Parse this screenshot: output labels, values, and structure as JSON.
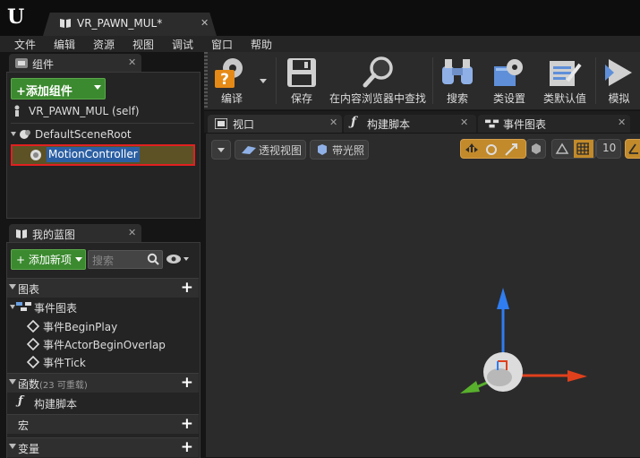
{
  "window": {
    "tab_title": "VR_PAWN_MUL*",
    "tab_close": "✕"
  },
  "menu": [
    "文件",
    "编辑",
    "资源",
    "视图",
    "调试",
    "窗口",
    "帮助"
  ],
  "components_panel": {
    "title": "组件",
    "close": "✕",
    "add_button": "+添加组件",
    "self_item": "VR_PAWN_MUL (self)",
    "root_item": "DefaultSceneRoot",
    "selected_item": "MotionController"
  },
  "blueprint_panel": {
    "title": "我的蓝图",
    "close": "✕",
    "add_new": "添加新项",
    "search_placeholder": "搜索",
    "sections": {
      "graphs": "图表",
      "functions": "函数",
      "functions_note": "(23 可重载)",
      "macros": "宏",
      "variables": "变量"
    },
    "event_graph": "事件图表",
    "events": [
      "事件BeginPlay",
      "事件ActorBeginOverlap",
      "事件Tick"
    ],
    "construct_script": "构建脚本"
  },
  "toolbar": {
    "compile": "编译",
    "save": "保存",
    "find_in_browser": "在内容浏览器中查找",
    "search": "搜索",
    "class_settings": "类设置",
    "class_defaults": "类默认值",
    "simulate": "模拟"
  },
  "editor_tabs": {
    "viewport": "视口",
    "construct": "构建脚本",
    "event_graph": "事件图表",
    "close": "✕"
  },
  "viewport": {
    "perspective": "透视视图",
    "lit": "带光照",
    "grid_size": "10"
  },
  "colors": {
    "accent_green": "#3b8a2f",
    "selection_red": "#e02020",
    "axis_blue": "#2f7df0",
    "axis_red": "#e0401c",
    "axis_green": "#58b02c"
  }
}
